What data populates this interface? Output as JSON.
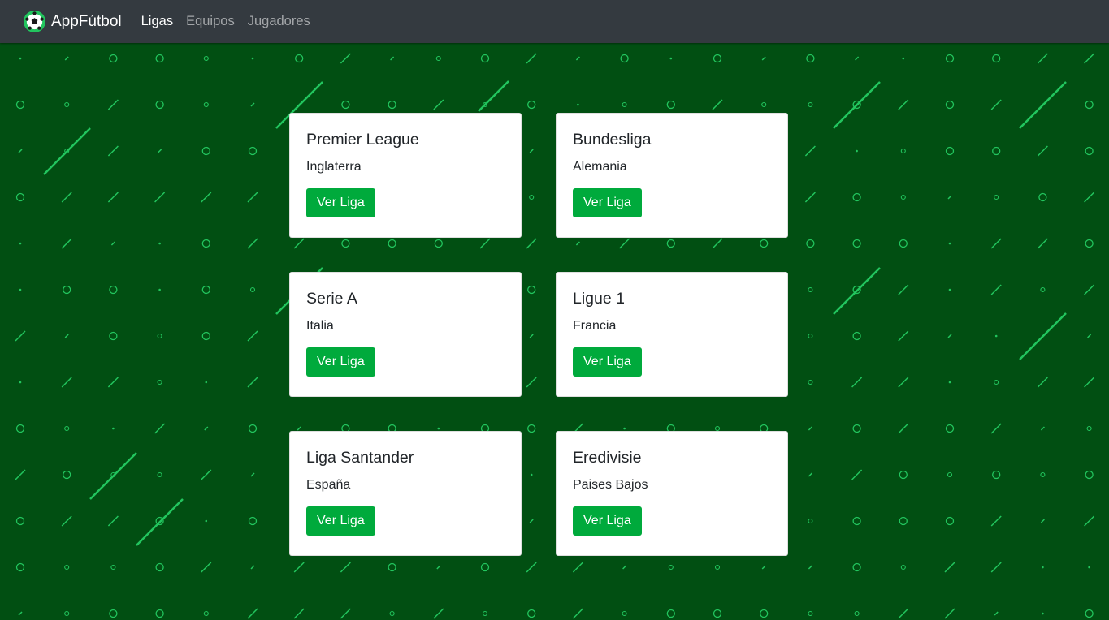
{
  "navbar": {
    "brand": "AppFútbol",
    "brand_icon": "soccer-ball-icon",
    "links": [
      {
        "label": "Ligas",
        "active": true
      },
      {
        "label": "Equipos",
        "active": false
      },
      {
        "label": "Jugadores",
        "active": false
      }
    ]
  },
  "leagues": [
    {
      "name": "Premier League",
      "country": "Inglaterra",
      "button": "Ver Liga"
    },
    {
      "name": "Bundesliga",
      "country": "Alemania",
      "button": "Ver Liga"
    },
    {
      "name": "Serie A",
      "country": "Italia",
      "button": "Ver Liga"
    },
    {
      "name": "Ligue 1",
      "country": "Francia",
      "button": "Ver Liga"
    },
    {
      "name": "Liga Santander",
      "country": "España",
      "button": "Ver Liga"
    },
    {
      "name": "Eredivisie",
      "country": "Paises Bajos",
      "button": "Ver Liga"
    }
  ],
  "colors": {
    "navbar": "#343a40",
    "background": "#014f12",
    "pattern": "#22c55e",
    "button": "#00aa3c"
  }
}
